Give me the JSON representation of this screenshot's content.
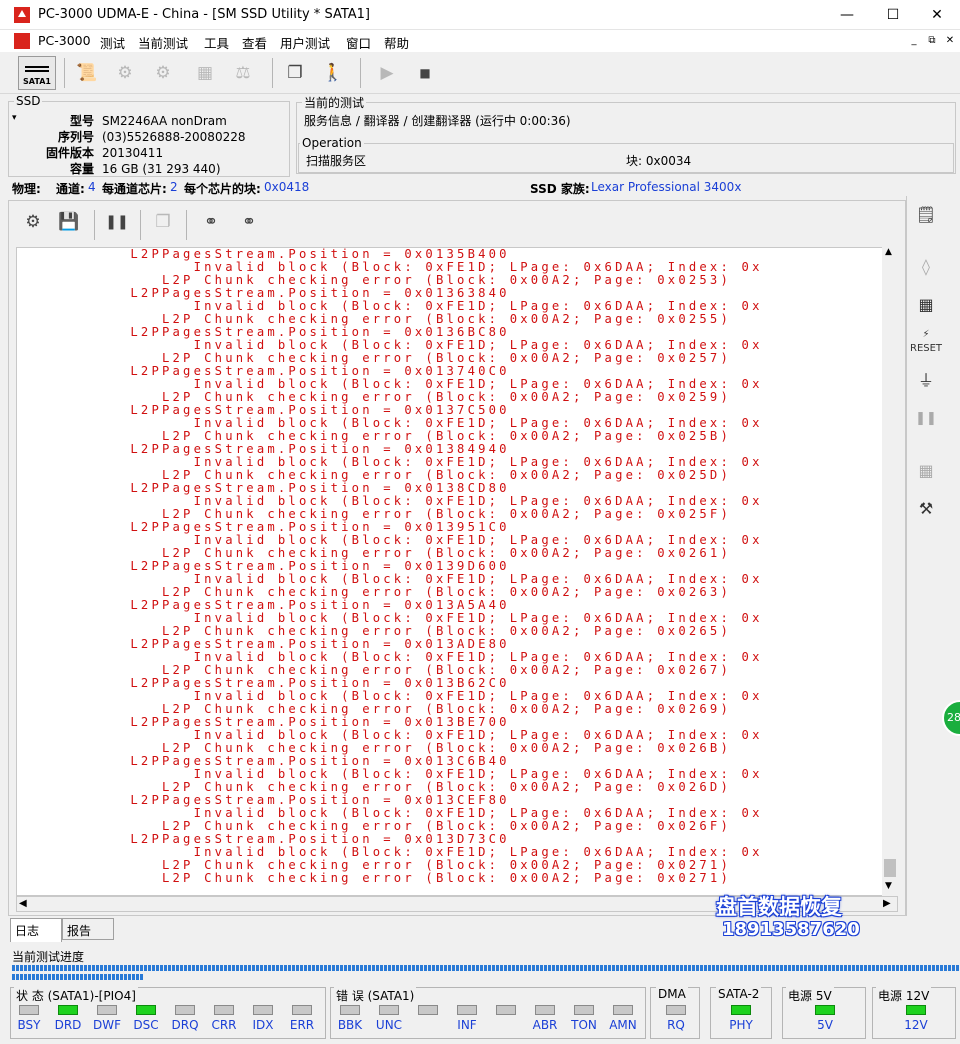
{
  "window": {
    "title": "PC-3000 UDMA-E - China - [SM SSD Utility * SATA1]"
  },
  "menu": [
    "PC-3000",
    "测试",
    "当前测试",
    "工具",
    "查看",
    "用户测试",
    "窗口",
    "帮助"
  ],
  "toolbar": {
    "sata_label": "SATA1"
  },
  "ssd": {
    "legend": "SSD",
    "fields": [
      {
        "k": "型号",
        "v": "SM2246AA nonDram"
      },
      {
        "k": "序列号",
        "v": "(03)5526888-20080228"
      },
      {
        "k": "固件版本",
        "v": "20130411"
      },
      {
        "k": "容量",
        "v": "16 GB (31 293 440)"
      }
    ]
  },
  "current_test": {
    "legend": "当前的测试",
    "value": "服务信息 / 翻译器 / 创建翻译器 (运行中 0:00:36)"
  },
  "operation": {
    "legend": "Operation",
    "value": "扫描服务区",
    "block_label": "块: 0x0034"
  },
  "statusline": {
    "physical": "物理:",
    "channels_label": "通道:",
    "channels": "4",
    "chips_label": "每通道芯片:",
    "chips": "2",
    "blocks_label": "每个芯片的块:",
    "blocks": "0x0418",
    "family_label": "SSD 家族:",
    "family": "Lexar Professional 3400x"
  },
  "log": {
    "lines": [
      "          L2PPagesStream.Position = 0x0135B400",
      "                Invalid block (Block: 0xFE1D; LPage: 0x6DAA; Index: 0x",
      "             L2P Chunk checking error (Block: 0x00A2; Page: 0x0253)",
      "          L2PPagesStream.Position = 0x01363840",
      "                Invalid block (Block: 0xFE1D; LPage: 0x6DAA; Index: 0x",
      "             L2P Chunk checking error (Block: 0x00A2; Page: 0x0255)",
      "          L2PPagesStream.Position = 0x0136BC80",
      "                Invalid block (Block: 0xFE1D; LPage: 0x6DAA; Index: 0x",
      "             L2P Chunk checking error (Block: 0x00A2; Page: 0x0257)",
      "          L2PPagesStream.Position = 0x013740C0",
      "                Invalid block (Block: 0xFE1D; LPage: 0x6DAA; Index: 0x",
      "             L2P Chunk checking error (Block: 0x00A2; Page: 0x0259)",
      "          L2PPagesStream.Position = 0x0137C500",
      "                Invalid block (Block: 0xFE1D; LPage: 0x6DAA; Index: 0x",
      "             L2P Chunk checking error (Block: 0x00A2; Page: 0x025B)",
      "          L2PPagesStream.Position = 0x01384940",
      "                Invalid block (Block: 0xFE1D; LPage: 0x6DAA; Index: 0x",
      "             L2P Chunk checking error (Block: 0x00A2; Page: 0x025D)",
      "          L2PPagesStream.Position = 0x0138CD80",
      "                Invalid block (Block: 0xFE1D; LPage: 0x6DAA; Index: 0x",
      "             L2P Chunk checking error (Block: 0x00A2; Page: 0x025F)",
      "          L2PPagesStream.Position = 0x013951C0",
      "                Invalid block (Block: 0xFE1D; LPage: 0x6DAA; Index: 0x",
      "             L2P Chunk checking error (Block: 0x00A2; Page: 0x0261)",
      "          L2PPagesStream.Position = 0x0139D600",
      "                Invalid block (Block: 0xFE1D; LPage: 0x6DAA; Index: 0x",
      "             L2P Chunk checking error (Block: 0x00A2; Page: 0x0263)",
      "          L2PPagesStream.Position = 0x013A5A40",
      "                Invalid block (Block: 0xFE1D; LPage: 0x6DAA; Index: 0x",
      "             L2P Chunk checking error (Block: 0x00A2; Page: 0x0265)",
      "          L2PPagesStream.Position = 0x013ADE80",
      "                Invalid block (Block: 0xFE1D; LPage: 0x6DAA; Index: 0x",
      "             L2P Chunk checking error (Block: 0x00A2; Page: 0x0267)",
      "          L2PPagesStream.Position = 0x013B62C0",
      "                Invalid block (Block: 0xFE1D; LPage: 0x6DAA; Index: 0x",
      "             L2P Chunk checking error (Block: 0x00A2; Page: 0x0269)",
      "          L2PPagesStream.Position = 0x013BE700",
      "                Invalid block (Block: 0xFE1D; LPage: 0x6DAA; Index: 0x",
      "             L2P Chunk checking error (Block: 0x00A2; Page: 0x026B)",
      "          L2PPagesStream.Position = 0x013C6B40",
      "                Invalid block (Block: 0xFE1D; LPage: 0x6DAA; Index: 0x",
      "             L2P Chunk checking error (Block: 0x00A2; Page: 0x026D)",
      "          L2PPagesStream.Position = 0x013CEF80",
      "                Invalid block (Block: 0xFE1D; LPage: 0x6DAA; Index: 0x",
      "             L2P Chunk checking error (Block: 0x00A2; Page: 0x026F)",
      "          L2PPagesStream.Position = 0x013D73C0",
      "                Invalid block (Block: 0xFE1D; LPage: 0x6DAA; Index: 0x",
      "             L2P Chunk checking error (Block: 0x00A2; Page: 0x0271)",
      "             L2P Chunk checking error (Block: 0x00A2; Page: 0x0271)"
    ]
  },
  "tabs": [
    "日志",
    "报告"
  ],
  "progress_label": "当前测试进度",
  "status": {
    "state_legend": "状 态 (SATA1)-[PIO4]",
    "state_leds": [
      {
        "l": "BSY",
        "on": false
      },
      {
        "l": "DRD",
        "on": true
      },
      {
        "l": "DWF",
        "on": false
      },
      {
        "l": "DSC",
        "on": true
      },
      {
        "l": "DRQ",
        "on": false
      },
      {
        "l": "CRR",
        "on": false
      },
      {
        "l": "IDX",
        "on": false
      },
      {
        "l": "ERR",
        "on": false
      }
    ],
    "error_legend": "错 误 (SATA1)",
    "error_leds": [
      {
        "l": "BBK",
        "on": false
      },
      {
        "l": "UNC",
        "on": false
      },
      {
        "l": "",
        "on": false
      },
      {
        "l": "INF",
        "on": false
      },
      {
        "l": "",
        "on": false
      },
      {
        "l": "ABR",
        "on": false
      },
      {
        "l": "TON",
        "on": false
      },
      {
        "l": "AMN",
        "on": false
      }
    ],
    "dma": {
      "legend": "DMA",
      "l": "RQ",
      "on": false
    },
    "sata2": {
      "legend": "SATA-2",
      "l": "PHY",
      "on": true
    },
    "p5": {
      "legend": "电源 5V",
      "l": "5V",
      "on": true
    },
    "p12": {
      "legend": "电源 12V",
      "l": "12V",
      "on": true
    }
  },
  "watermark": {
    "name": "盘首数据恢复",
    "phone": "18913587620"
  },
  "badge": "28"
}
